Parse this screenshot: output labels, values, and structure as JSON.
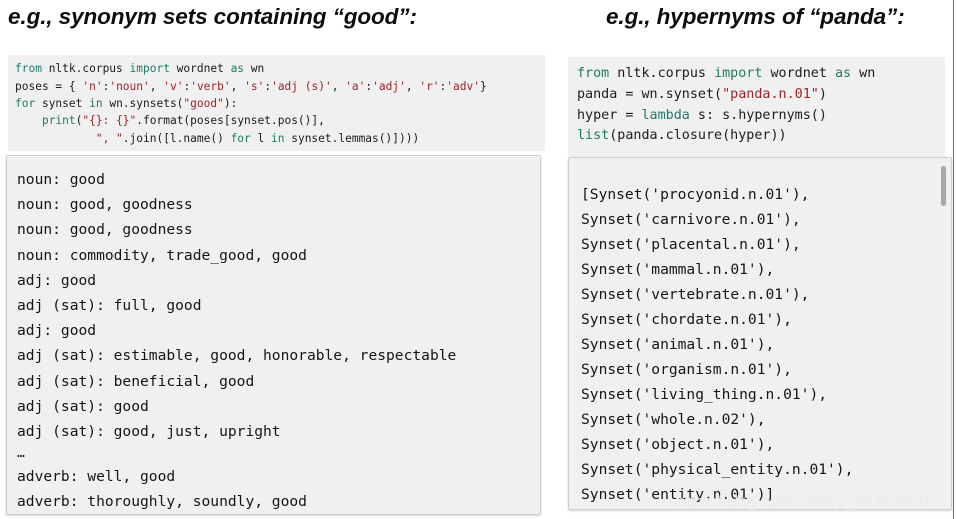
{
  "slide": {
    "background_color": "#ffffff",
    "edge_line_color": "#7a6a55"
  },
  "left_column": {
    "title": "e.g., synonym sets containing “good”:",
    "code": {
      "language": "python",
      "lines": [
        "from nltk.corpus import wordnet as wn",
        "poses = { 'n':'noun', 'v':'verb', 's':'adj (s)', 'a':'adj', 'r':'adv'}",
        "for synset in wn.synsets(\"good\"):",
        "    print(\"{}: {}\".format(poses[synset.pos()],",
        "            \", \".join([l.name() for l in synset.lemmas()])))"
      ],
      "keyword_color": "#1f7a66",
      "string_color": "#9b2226",
      "background_color": "#f0f0f0"
    },
    "output": {
      "lines": [
        "noun: good",
        "noun: good, goodness",
        "noun: good, goodness",
        "noun: commodity, trade_good, good",
        "adj: good",
        "adj (sat): full, good",
        "adj: good",
        "adj (sat): estimable, good, honorable, respectable",
        "adj (sat): beneficial, good",
        "adj (sat): good",
        "adj (sat): good, just, upright",
        "…",
        "adverb: well, good",
        "adverb: thoroughly, soundly, good"
      ],
      "background_color": "#f0f0f0",
      "border_color": "#cfcfcf"
    }
  },
  "right_column": {
    "title": "e.g., hypernyms of “panda”:",
    "code": {
      "language": "python",
      "lines": [
        "from nltk.corpus import wordnet as wn",
        "panda = wn.synset(\"panda.n.01\")",
        "hyper = lambda s: s.hypernyms()",
        "list(panda.closure(hyper))"
      ],
      "keyword_color": "#1f7a66",
      "string_color": "#9b2226",
      "background_color": "#f0f0f0"
    },
    "output": {
      "lines": [
        "[Synset('procyonid.n.01'),",
        "Synset('carnivore.n.01'),",
        "Synset('placental.n.01'),",
        "Synset('mammal.n.01'),",
        "Synset('vertebrate.n.01'),",
        "Synset('chordate.n.01'),",
        "Synset('animal.n.01'),",
        "Synset('organism.n.01'),",
        "Synset('living_thing.n.01'),",
        "Synset('whole.n.02'),",
        "Synset('object.n.01'),",
        "Synset('physical_entity.n.01'),",
        "Synset('entity.n.01')]"
      ],
      "background_color": "#f0f0f0",
      "border_color": "#cfcfcf",
      "scrollbar": {
        "thumb_color": "#a8a8a8",
        "position": "top"
      }
    }
  },
  "watermark": {
    "text": "https://blog.csdn.net/qq_41897800"
  }
}
